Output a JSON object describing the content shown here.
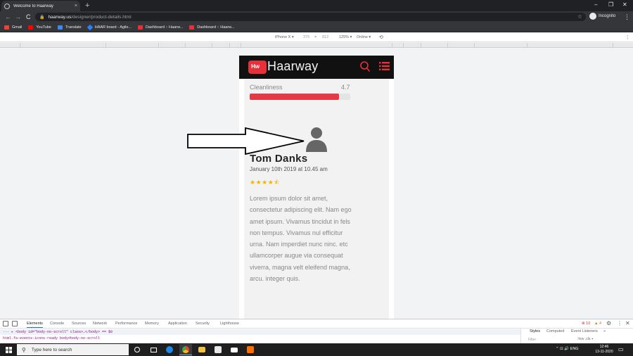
{
  "browser": {
    "tab_title": "Welcome to Haarway",
    "tab_close": "×",
    "new_tab": "+",
    "window_controls": {
      "minimize": "–",
      "restore": "❐",
      "close": "✕"
    },
    "nav": {
      "back": "←",
      "forward": "→",
      "reload": "C"
    },
    "url_host": "haarway.us",
    "url_path": "/designer/product-details.html",
    "bookmark_star": "☆",
    "profile_label": "Incognito",
    "menu": "⋮",
    "bookmarks": [
      {
        "label": "Gmail",
        "color": "#ea4335"
      },
      {
        "label": "YouTube",
        "color": "#ff0000"
      },
      {
        "label": "Translate",
        "color": "#4285f4"
      },
      {
        "label": "HAAR board - Agile...",
        "color": "#2684ff"
      },
      {
        "label": "Dashboard :: Haarw...",
        "color": "#e8303a"
      },
      {
        "label": "Dashboard :: Haarw...",
        "color": "#e8303a"
      }
    ]
  },
  "device_toolbar": {
    "device": "iPhone X ▾",
    "width": "375",
    "times": "×",
    "height": "812",
    "zoom": "125% ▾",
    "network": "Online ▾",
    "rotate": "⟲"
  },
  "site": {
    "logo_badge": "Hw",
    "brand_name": "Haarway",
    "brand_color": "#e8303a",
    "rating": {
      "label": "Cleanliness",
      "value": "4.7",
      "fill_fraction": 0.89
    },
    "review": {
      "name": "Tom Danks",
      "date": "January 10th 2019 at 10.45 am",
      "stars": 4.5,
      "star_glyphs": [
        "★",
        "★",
        "★",
        "★",
        "⯪"
      ],
      "body": "Lorem ipsum dolor sit amet, consectetur adipiscing elit. Nam ego amet ipsum. Vivamus tincidut in fels non tempus. Vivamus nul efficitur urna. Nam imperdiet nunc ninc. etc ullamcorper augue via consequat viverra, magna velt eleifend magna, arcu. integer quis."
    }
  },
  "devtools": {
    "tabs": [
      "Elements",
      "Console",
      "Sources",
      "Network",
      "Performance",
      "Memory",
      "Application",
      "Security",
      "Lighthouse"
    ],
    "errors": "⊗ 10",
    "warnings": "▲ 4",
    "code_line": "··· ▸ <body id=\"body-no-scroll\" class>…</body> == $0",
    "breadcrumb": "html.fa-events-icons-ready   body#body-no-scroll",
    "side_tabs": [
      "Styles",
      "Computed",
      "Event Listeners",
      "»"
    ],
    "filter_placeholder": "Filter",
    "filter_opts": ":hov  .cls  +"
  },
  "taskbar": {
    "search_placeholder": "Type here to search",
    "tray_text": "⌃  ⊡ 🔊  ENG",
    "time": "12:46",
    "date": "13-11-2020",
    "notification": "2"
  }
}
